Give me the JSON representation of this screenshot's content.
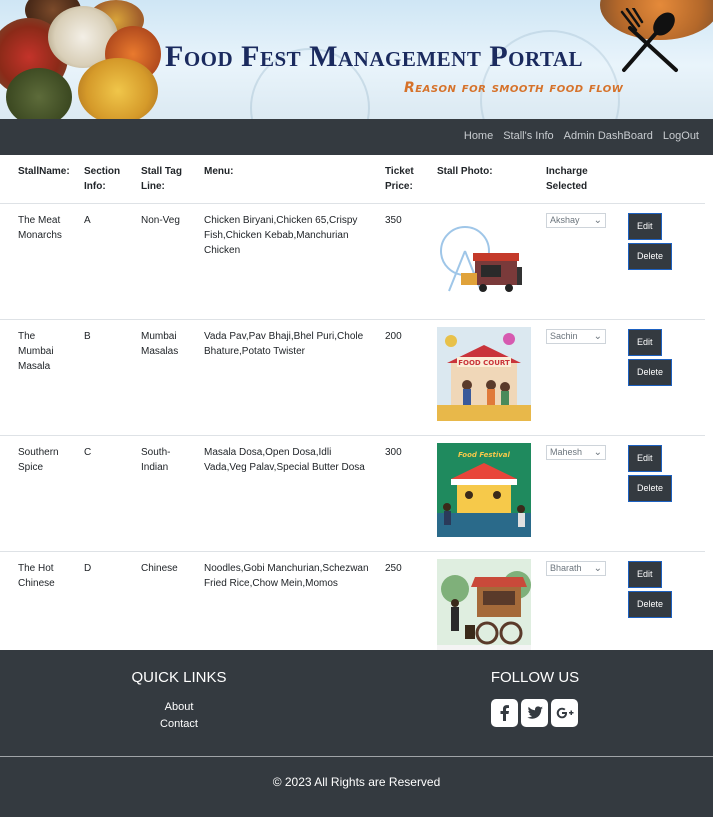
{
  "header": {
    "title": "Food Fest Management Portal",
    "subtitle": "Reason for smooth food flow"
  },
  "nav": {
    "items": [
      "Home",
      "Stall's Info",
      "Admin DashBoard",
      "LogOut"
    ]
  },
  "table": {
    "headers": [
      "StallName:",
      "Section Info:",
      "Stall Tag Line:",
      "Menu:",
      "Ticket Price:",
      "Stall Photo:",
      "Incharge Selected",
      ""
    ],
    "rows": [
      {
        "name": "The Meat Monarchs",
        "section": "A",
        "tagline": "Non-Veg",
        "menu": "Chicken Biryani,Chicken 65,Crispy Fish,Chicken Kebab,Manchurian Chicken",
        "price": "350",
        "incharge": "Akshay",
        "photo": "food-truck-photo",
        "edit": "Edit",
        "delete": "Delete"
      },
      {
        "name": "The Mumbai Masala",
        "section": "B",
        "tagline": "Mumbai Masalas",
        "menu": "Vada Pav,Pav Bhaji,Bhel Puri,Chole Bhature,Potato Twister",
        "price": "200",
        "incharge": "Sachin",
        "photo": "food-court-photo",
        "edit": "Edit",
        "delete": "Delete",
        "photo_text": "FOOD COURT"
      },
      {
        "name": "Southern Spice",
        "section": "C",
        "tagline": "South-Indian",
        "menu": "Masala Dosa,Open Dosa,Idli Vada,Veg Palav,Special Butter Dosa",
        "price": "300",
        "incharge": "Mahesh",
        "photo": "food-festival-photo",
        "edit": "Edit",
        "delete": "Delete",
        "photo_text": "Food Festival"
      },
      {
        "name": "The Hot Chinese",
        "section": "D",
        "tagline": "Chinese",
        "menu": "Noodles,Gobi Manchurian,Schezwan Fried Rice,Chow Mein,Momos",
        "price": "250",
        "incharge": "Bharath",
        "photo": "food-cart-photo",
        "edit": "Edit",
        "delete": "Delete"
      }
    ]
  },
  "footer": {
    "quick_links_heading": "QUICK LINKS",
    "quick_links": [
      "About",
      "Contact"
    ],
    "follow_heading": "FOLLOW US",
    "social": [
      "facebook-icon",
      "twitter-icon",
      "google-plus-icon"
    ],
    "copyright": "© 2023 All Rights are Reserved"
  },
  "colors": {
    "navbar": "#343a40",
    "title": "#1a2a5e",
    "subtitle": "#d6722a",
    "button_border": "#1d61c1"
  }
}
